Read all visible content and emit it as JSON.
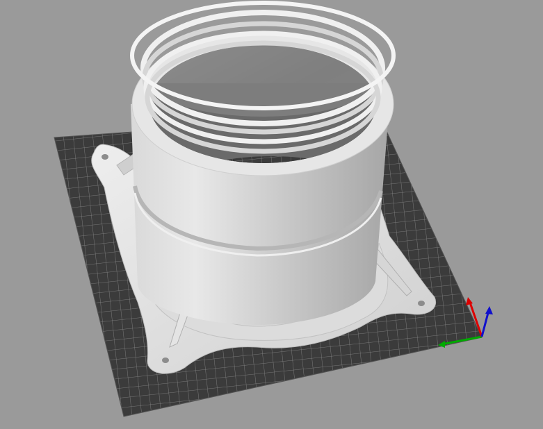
{
  "viewport": {
    "background": "#9a9a9a",
    "bed_color": "#3b3b3b",
    "bed_grid_color": "#8a8a8a",
    "model_color": "#e2e2e2"
  },
  "model": {
    "name": "",
    "features": [
      "mounting-flange",
      "threaded-tube",
      "support-ribs",
      "screw-holes"
    ]
  },
  "axes": {
    "x_color": "#00aa00",
    "y_color": "#dd0000",
    "z_color": "#1010cc",
    "icon": "axes-gizmo-icon"
  }
}
